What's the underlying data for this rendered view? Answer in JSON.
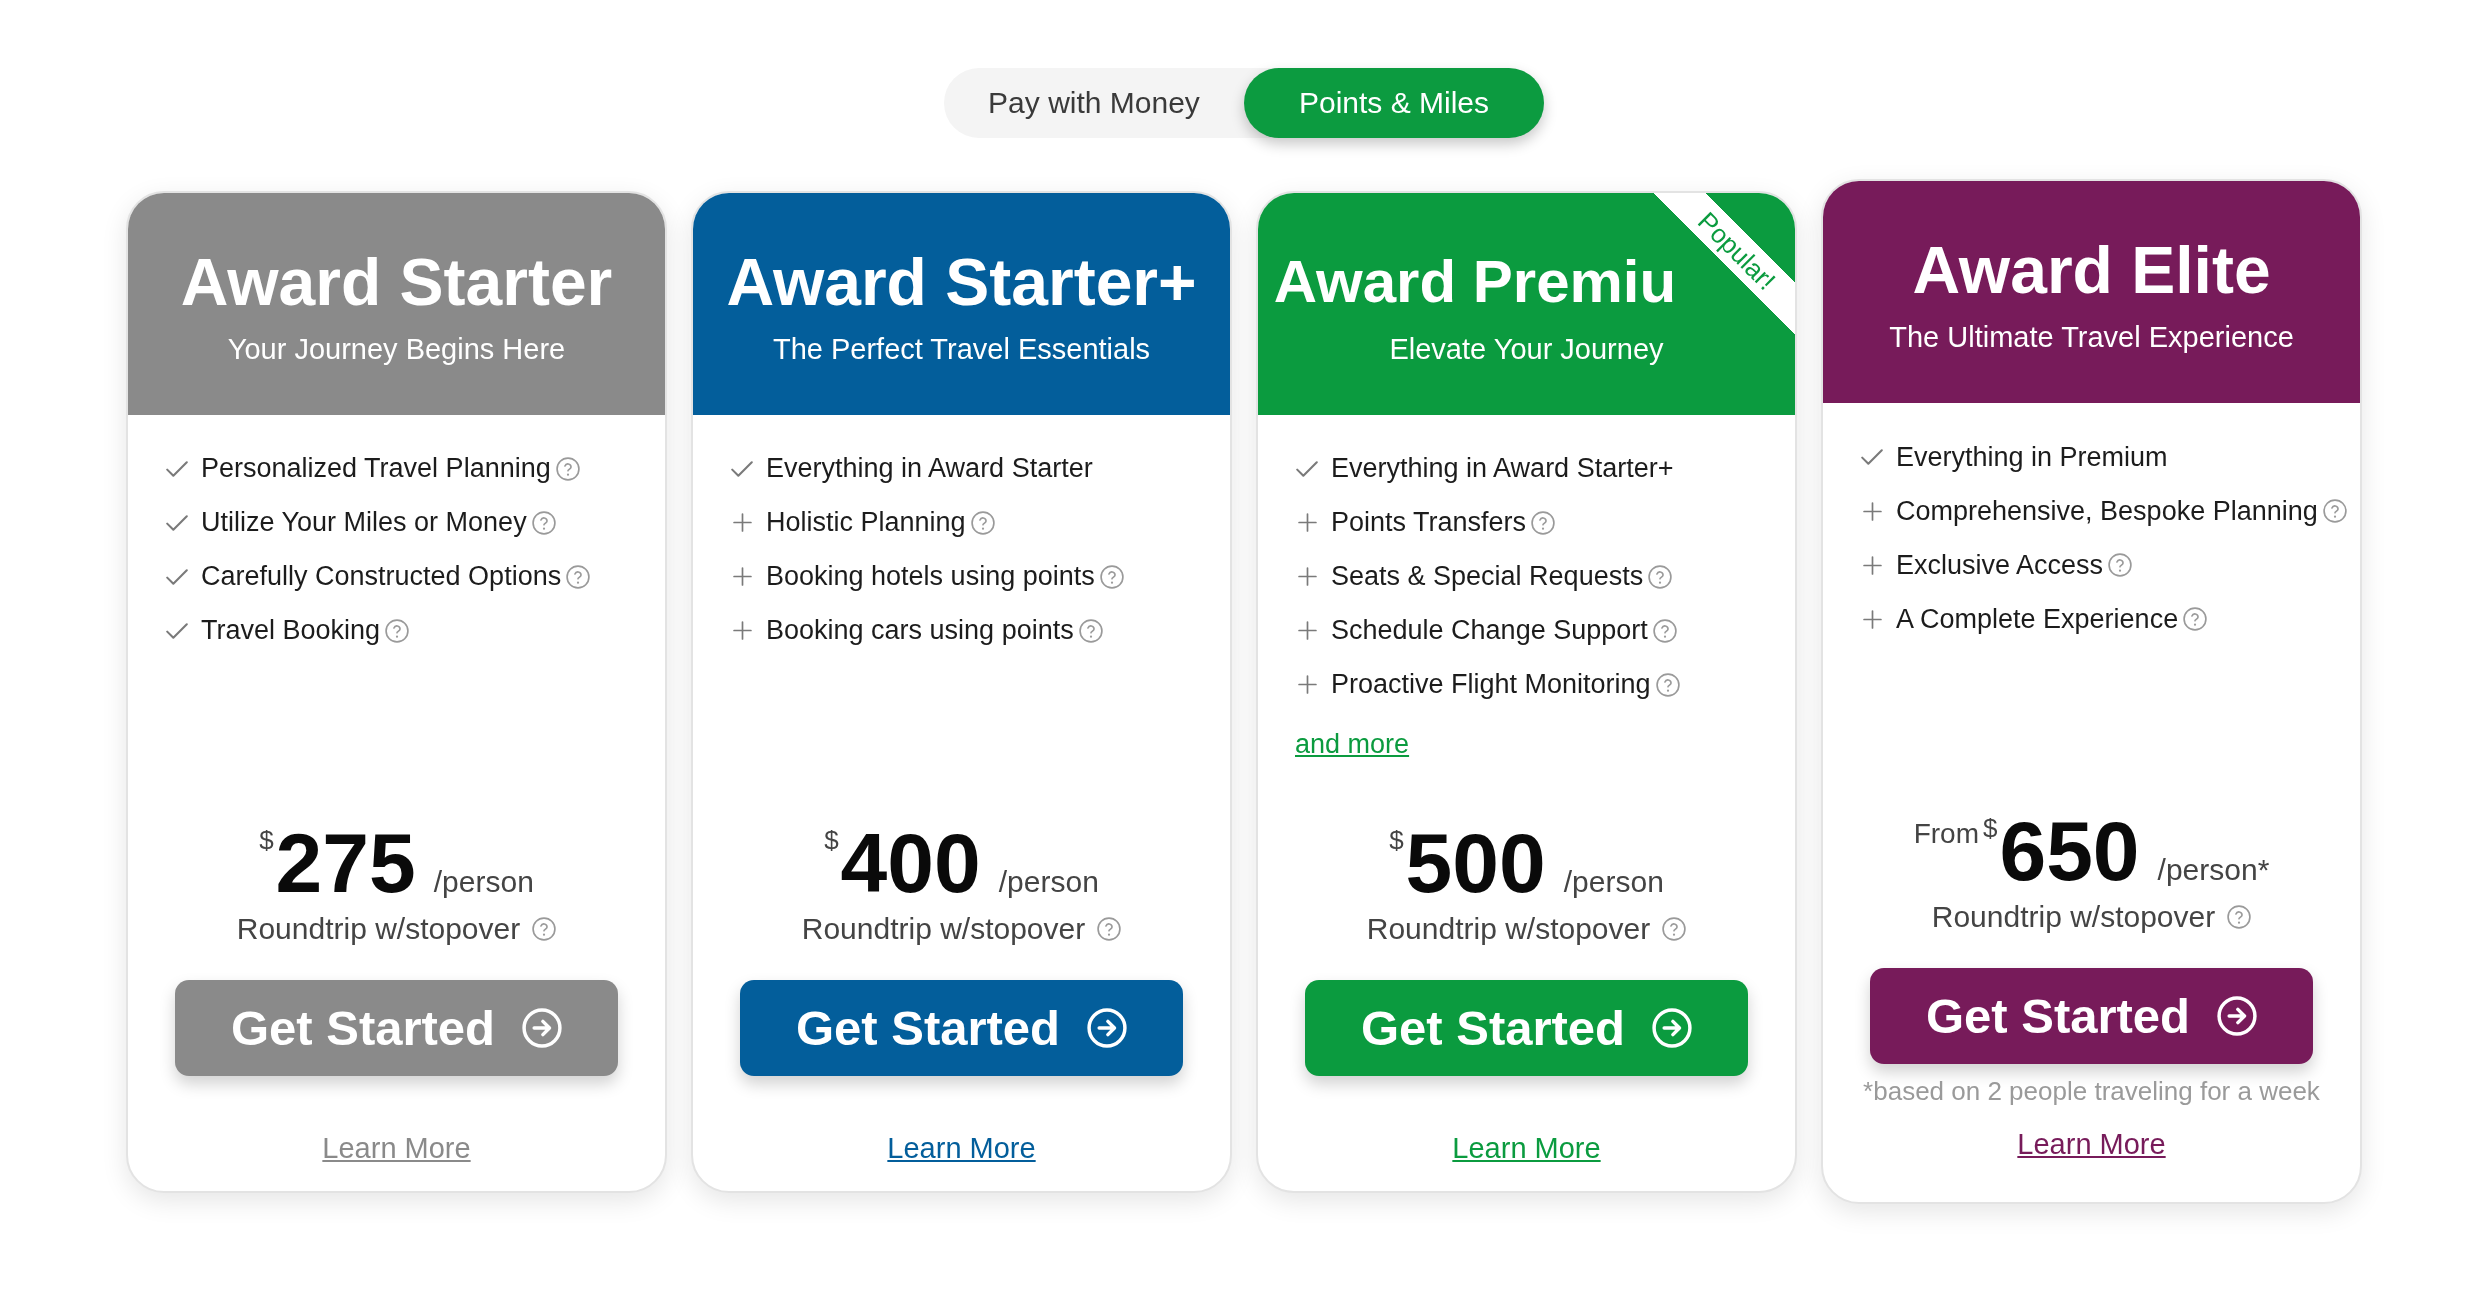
{
  "payment_toggle": [
    {
      "label": "Pay with Money",
      "selected": false
    },
    {
      "label": "Points & Miles",
      "selected": true
    }
  ],
  "plans": [
    {
      "title": "Award Starter",
      "subtitle": "Your Journey Begins Here",
      "color": "#8a8a8a",
      "features": [
        {
          "kind": "included",
          "text": "Personalized Travel Planning",
          "help": true
        },
        {
          "kind": "included",
          "text": "Utilize Your Miles or Money",
          "help": true
        },
        {
          "kind": "included",
          "text": "Carefully Constructed Options",
          "help": true
        },
        {
          "kind": "included",
          "text": "Travel Booking",
          "help": true
        }
      ],
      "price": {
        "currency": "$",
        "amount": "275",
        "unit": "/person",
        "note": "Roundtrip w/stopover",
        "help": true
      },
      "button": "Get Started",
      "link": "Learn More"
    },
    {
      "title": "Award Starter+",
      "subtitle": "The Perfect Travel Essentials",
      "color": "#035e9b",
      "features": [
        {
          "kind": "included",
          "text": "Everything in Award Starter",
          "help": false
        },
        {
          "kind": "added",
          "text": "Holistic Planning",
          "help": true
        },
        {
          "kind": "added",
          "text": "Booking hotels using points",
          "help": true
        },
        {
          "kind": "added",
          "text": "Booking cars using points",
          "help": true
        }
      ],
      "price": {
        "currency": "$",
        "amount": "400",
        "unit": "/person",
        "note": "Roundtrip w/stopover",
        "help": true
      },
      "button": "Get Started",
      "link": "Learn More"
    },
    {
      "title": "Award Premiu",
      "subtitle": "Elevate Your Journey",
      "color": "#0b9b3f",
      "ribbon": "Popular!",
      "features": [
        {
          "kind": "included",
          "text": "Everything in Award Starter+",
          "help": false
        },
        {
          "kind": "added",
          "text": "Points Transfers",
          "help": true
        },
        {
          "kind": "added",
          "text": "Seats & Special Requests",
          "help": true
        },
        {
          "kind": "added",
          "text": "Schedule Change Support",
          "help": true
        },
        {
          "kind": "added",
          "text": "Proactive Flight Monitoring",
          "help": true
        }
      ],
      "more_link": "and more",
      "price": {
        "currency": "$",
        "amount": "500",
        "unit": "/person",
        "note": "Roundtrip w/stopover",
        "help": true
      },
      "button": "Get Started",
      "link": "Learn More"
    },
    {
      "title": "Award Elite",
      "subtitle": "The Ultimate Travel Experience",
      "color": "#771b5a",
      "features": [
        {
          "kind": "included",
          "text": "Everything in Premium",
          "help": false
        },
        {
          "kind": "added",
          "text": "Comprehensive, Bespoke Planning",
          "help": true
        },
        {
          "kind": "added",
          "text": "Exclusive Access",
          "help": true
        },
        {
          "kind": "added",
          "text": "A Complete Experience",
          "help": true
        }
      ],
      "price": {
        "prefix": "From",
        "currency": "$",
        "amount": "650",
        "unit": "/person*",
        "note": "Roundtrip w/stopover",
        "help": true
      },
      "button": "Get Started",
      "footnote": "*based on 2 people traveling for a week",
      "link": "Learn More"
    }
  ]
}
